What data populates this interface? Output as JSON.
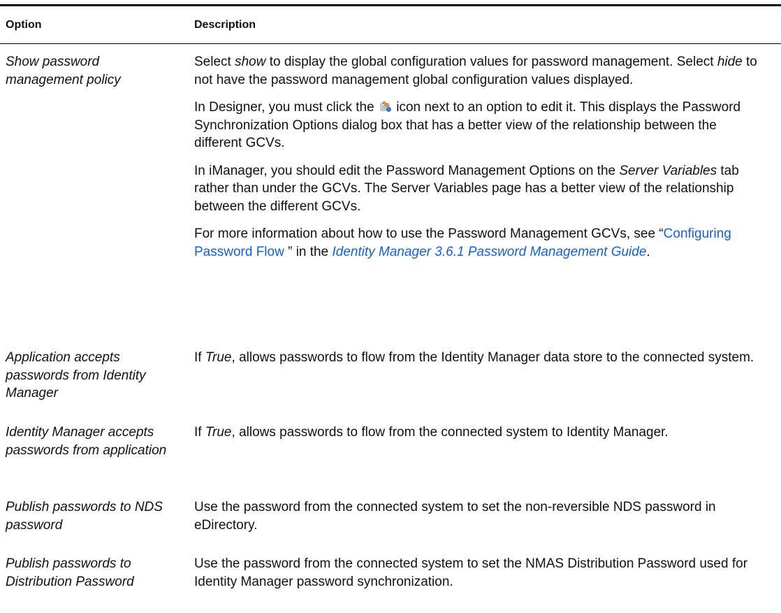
{
  "table": {
    "headers": {
      "option": "Option",
      "description": "Description"
    },
    "rows": [
      {
        "option": "Show password management policy",
        "paras": {
          "p1": {
            "a": "Select ",
            "b": "show",
            "c": " to display the global configuration values for password management. Select ",
            "d": "hide",
            "e": " to not have the password management global configuration values displayed."
          },
          "p2": {
            "a": "In Designer, you must click the ",
            "icon": "edit-gcv-icon",
            "b": " icon next to an option to edit it. This displays the Password Synchronization Options dialog box that has a better view of the relationship between the different GCVs."
          },
          "p3": {
            "a": "In iManager, you should edit the Password Management Options on the ",
            "b": "Server Variables",
            "c": " tab rather than under the GCVs. The Server Variables page has a better view of the relationship between the different GCVs."
          },
          "p4": {
            "a": "For more information about how to use the Password Management GCVs, see “",
            "link1": "Configuring Password Flow ",
            "b": "” in the ",
            "link2": "Identity Manager 3.6.1 Password Management Guide",
            "c": "."
          }
        }
      },
      {
        "option": "Application accepts passwords from Identity Manager",
        "desc": {
          "a": "If ",
          "b": "True",
          "c": ", allows passwords to flow from the Identity Manager data store to the connected system."
        }
      },
      {
        "option": "Identity Manager accepts passwords from application",
        "desc": {
          "a": "If ",
          "b": "True",
          "c": ", allows passwords to flow from the connected system to Identity Manager."
        }
      },
      {
        "option": "Publish passwords to NDS password",
        "desc": {
          "a": "Use the password from the connected system to set the non-reversible NDS password in eDirectory."
        }
      },
      {
        "option": "Publish passwords to Distribution Password",
        "desc": {
          "a": "Use the password from the connected system to set the NMAS Distribution Password used for Identity Manager password synchronization."
        }
      }
    ]
  },
  "colors": {
    "link": "#1560d6",
    "rule": "#000000",
    "text": "#111111"
  }
}
